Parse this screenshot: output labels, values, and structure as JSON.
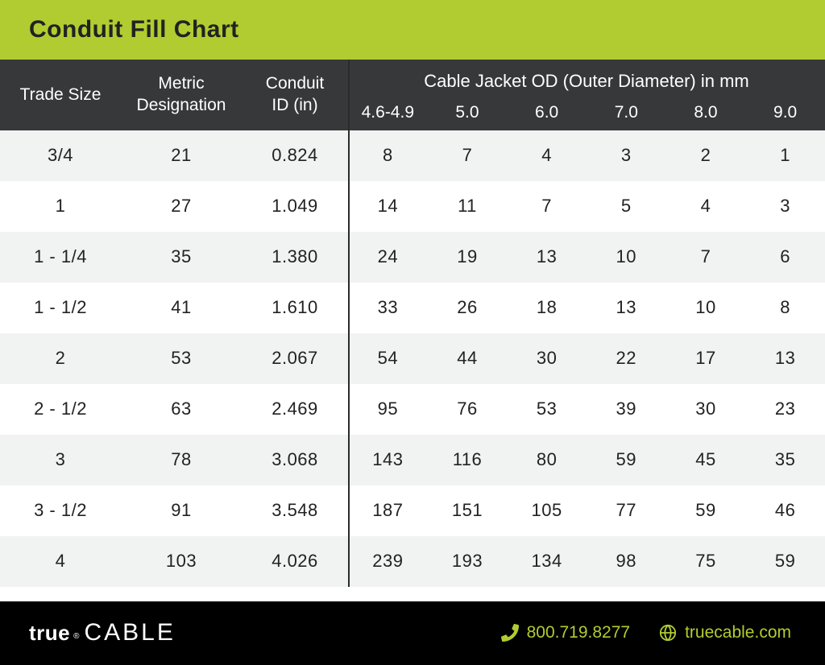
{
  "title": "Conduit Fill Chart",
  "headers": {
    "trade_size": "Trade Size",
    "metric_designation": "Metric\nDesignation",
    "conduit_id": "Conduit\nID (in)",
    "od_super": "Cable Jacket OD (Outer Diameter) in mm",
    "od_cols": [
      "4.6-4.9",
      "5.0",
      "6.0",
      "7.0",
      "8.0",
      "9.0"
    ]
  },
  "rows": [
    {
      "trade": "3/4",
      "metric": "21",
      "conduit": "0.824",
      "vals": [
        "8",
        "7",
        "4",
        "3",
        "2",
        "1"
      ]
    },
    {
      "trade": "1",
      "metric": "27",
      "conduit": "1.049",
      "vals": [
        "14",
        "11",
        "7",
        "5",
        "4",
        "3"
      ]
    },
    {
      "trade": "1 - 1/4",
      "metric": "35",
      "conduit": "1.380",
      "vals": [
        "24",
        "19",
        "13",
        "10",
        "7",
        "6"
      ]
    },
    {
      "trade": "1 - 1/2",
      "metric": "41",
      "conduit": "1.610",
      "vals": [
        "33",
        "26",
        "18",
        "13",
        "10",
        "8"
      ]
    },
    {
      "trade": "2",
      "metric": "53",
      "conduit": "2.067",
      "vals": [
        "54",
        "44",
        "30",
        "22",
        "17",
        "13"
      ]
    },
    {
      "trade": "2 - 1/2",
      "metric": "63",
      "conduit": "2.469",
      "vals": [
        "95",
        "76",
        "53",
        "39",
        "30",
        "23"
      ]
    },
    {
      "trade": "3",
      "metric": "78",
      "conduit": "3.068",
      "vals": [
        "143",
        "116",
        "80",
        "59",
        "45",
        "35"
      ]
    },
    {
      "trade": "3 - 1/2",
      "metric": "91",
      "conduit": "3.548",
      "vals": [
        "187",
        "151",
        "105",
        "77",
        "59",
        "46"
      ]
    },
    {
      "trade": "4",
      "metric": "103",
      "conduit": "4.026",
      "vals": [
        "239",
        "193",
        "134",
        "98",
        "75",
        "59"
      ]
    }
  ],
  "footer": {
    "brand_true": "true",
    "brand_reg": "®",
    "brand_cable": "CABLE",
    "phone": "800.719.8277",
    "website": "truecable.com"
  },
  "chart_data": {
    "type": "table",
    "title": "Conduit Fill Chart",
    "columns": [
      "Trade Size",
      "Metric Designation",
      "Conduit ID (in)",
      "4.6-4.9",
      "5.0",
      "6.0",
      "7.0",
      "8.0",
      "9.0"
    ],
    "column_group": {
      "label": "Cable Jacket OD (Outer Diameter) in mm",
      "span_columns": [
        "4.6-4.9",
        "5.0",
        "6.0",
        "7.0",
        "8.0",
        "9.0"
      ]
    },
    "data": [
      [
        "3/4",
        21,
        0.824,
        8,
        7,
        4,
        3,
        2,
        1
      ],
      [
        "1",
        27,
        1.049,
        14,
        11,
        7,
        5,
        4,
        3
      ],
      [
        "1 - 1/4",
        35,
        1.38,
        24,
        19,
        13,
        10,
        7,
        6
      ],
      [
        "1 - 1/2",
        41,
        1.61,
        33,
        26,
        18,
        13,
        10,
        8
      ],
      [
        "2",
        53,
        2.067,
        54,
        44,
        30,
        22,
        17,
        13
      ],
      [
        "2 - 1/2",
        63,
        2.469,
        95,
        76,
        53,
        39,
        30,
        23
      ],
      [
        "3",
        78,
        3.068,
        143,
        116,
        80,
        59,
        45,
        35
      ],
      [
        "3 - 1/2",
        91,
        3.548,
        187,
        151,
        105,
        77,
        59,
        46
      ],
      [
        "4",
        103,
        4.026,
        239,
        193,
        134,
        98,
        75,
        59
      ]
    ]
  }
}
